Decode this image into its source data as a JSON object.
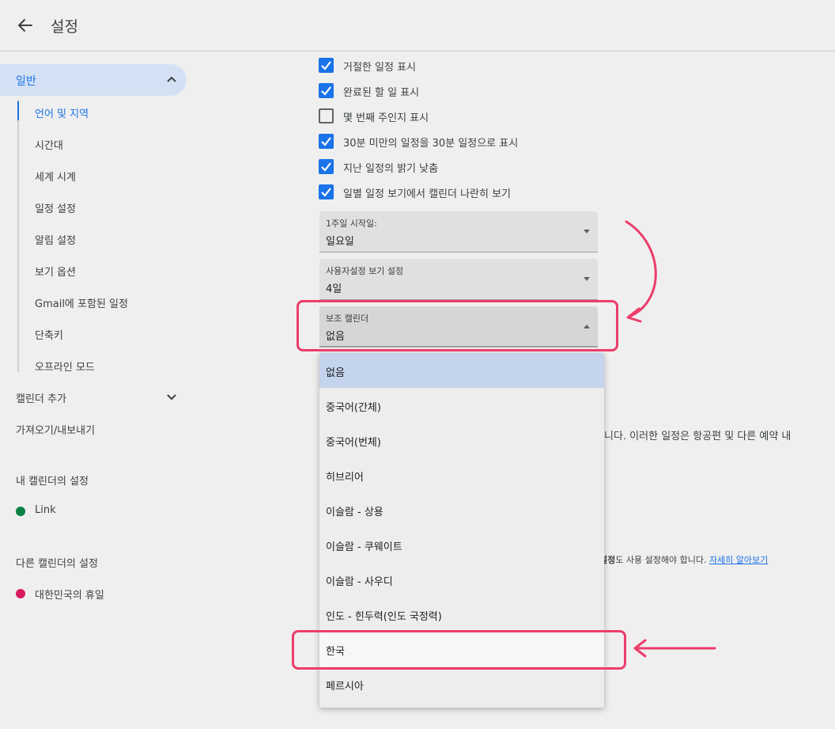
{
  "header": {
    "title": "설정",
    "back_icon": "arrow-left-icon"
  },
  "sidebar": {
    "section_general": "일반",
    "sub_items": [
      "언어 및 지역",
      "시간대",
      "세계 시계",
      "일정 설정",
      "알림 설정",
      "보기 옵션",
      "Gmail에 포함된 일정",
      "단축키",
      "오프라인 모드"
    ],
    "active_sub_index": 0,
    "add_calendar": "캘린더 추가",
    "import_export": "가져오기/내보내기",
    "my_calendars_title": "내 캘린더의 설정",
    "my_calendars": [
      {
        "name": "Link",
        "color": "#0b8043"
      }
    ],
    "other_calendars_title": "다른 캘린더의 설정",
    "other_calendars": [
      {
        "name": "대한민국의 휴일",
        "color": "#d81b60"
      }
    ]
  },
  "options": [
    {
      "label": "거절한 일정 표시",
      "checked": true
    },
    {
      "label": "완료된 할 일 표시",
      "checked": true
    },
    {
      "label": "몇 번째 주인지 표시",
      "checked": false
    },
    {
      "label": "30분 미만의 일정을 30분 일정으로 표시",
      "checked": true
    },
    {
      "label": "지난 일정의 밝기 낮춤",
      "checked": true
    },
    {
      "label": "일별 일정 보기에서 캘린더 나란히 보기",
      "checked": true
    }
  ],
  "week_start": {
    "label": "1주일 시작일:",
    "value": "일요일"
  },
  "custom_view": {
    "label": "사용자설정 보기 설정",
    "value": "4일"
  },
  "alt_calendar": {
    "label": "보조 캘린더",
    "value": "없음"
  },
  "dropdown": {
    "options": [
      "없음",
      "중국어(간체)",
      "중국어(번체)",
      "히브리어",
      "이슬람 - 상용",
      "이슬람 - 쿠웨이트",
      "이슬람 - 사우디",
      "인도 - 힌두력(인도 국정력)",
      "한국",
      "페르시아"
    ],
    "selected_index": 0,
    "highlighted_index": 8
  },
  "background_text": {
    "line1": "니다. 이러한 일정은 항공편 및 다른 예약 내",
    "small_bold": "설정",
    "small_rest": "도 사용 설정해야 합니다. ",
    "small_link": "자세히 알아보기"
  },
  "colors": {
    "accent": "#1a73e8",
    "annotation": "#ec3d6b",
    "selected_bg": "#c3d4ec"
  }
}
